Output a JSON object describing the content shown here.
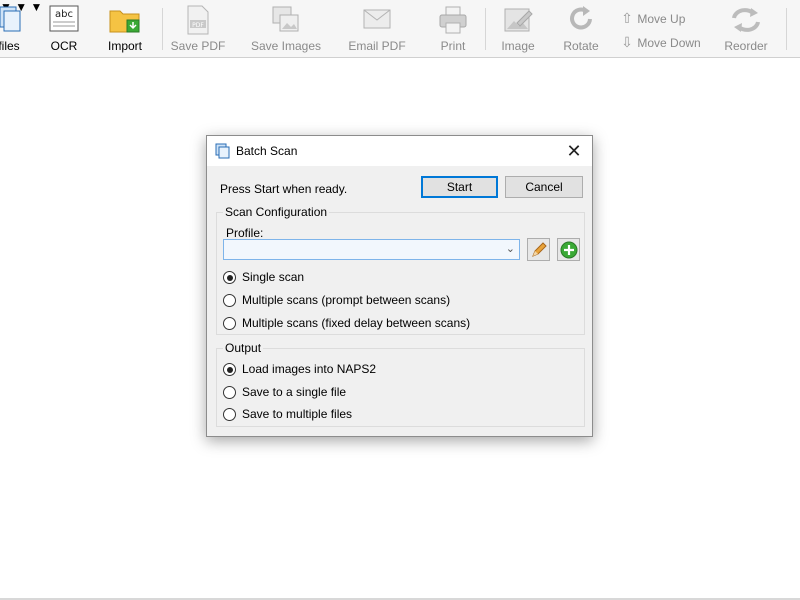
{
  "toolbar": {
    "items": [
      {
        "label": "files",
        "enabled": true,
        "icon": "files-icon"
      },
      {
        "label": "OCR",
        "enabled": true,
        "icon": "ocr-icon"
      },
      {
        "label": "Import",
        "enabled": true,
        "icon": "import-folder-icon"
      },
      {
        "label": "Save PDF",
        "enabled": false,
        "icon": "pdf-icon"
      },
      {
        "label": "Save Images",
        "enabled": false,
        "icon": "images-icon"
      },
      {
        "label": "Email PDF",
        "enabled": false,
        "icon": "email-icon"
      },
      {
        "label": "Print",
        "enabled": false,
        "icon": "printer-icon"
      },
      {
        "label": "Image",
        "enabled": false,
        "icon": "image-edit-icon"
      },
      {
        "label": "Rotate",
        "enabled": false,
        "icon": "rotate-icon"
      },
      {
        "label": "Move Up",
        "enabled": false,
        "icon": "arrow-up-icon"
      },
      {
        "label": "Move Down",
        "enabled": false,
        "icon": "arrow-down-icon"
      },
      {
        "label": "Reorder",
        "enabled": false,
        "icon": "reorder-icon"
      }
    ],
    "ocr_icon_text": "abc"
  },
  "dialog": {
    "title": "Batch Scan",
    "status": "Press Start when ready.",
    "start_label": "Start",
    "cancel_label": "Cancel",
    "scan_config": {
      "legend": "Scan Configuration",
      "profile_label": "Profile:",
      "profile_value": "",
      "options": [
        {
          "label": "Single scan",
          "selected": true
        },
        {
          "label": "Multiple scans (prompt between scans)",
          "selected": false
        },
        {
          "label": "Multiple scans (fixed delay between scans)",
          "selected": false
        }
      ]
    },
    "output": {
      "legend": "Output",
      "options": [
        {
          "label": "Load images into NAPS2",
          "selected": true
        },
        {
          "label": "Save to a single file",
          "selected": false
        },
        {
          "label": "Save to multiple files",
          "selected": false
        }
      ]
    }
  },
  "colors": {
    "accent": "#0078d7",
    "dialog_bg": "#f0f0f0",
    "disabled_text": "#8a8a8a",
    "add_green": "#3aa935",
    "edit_orange": "#e0a030"
  }
}
